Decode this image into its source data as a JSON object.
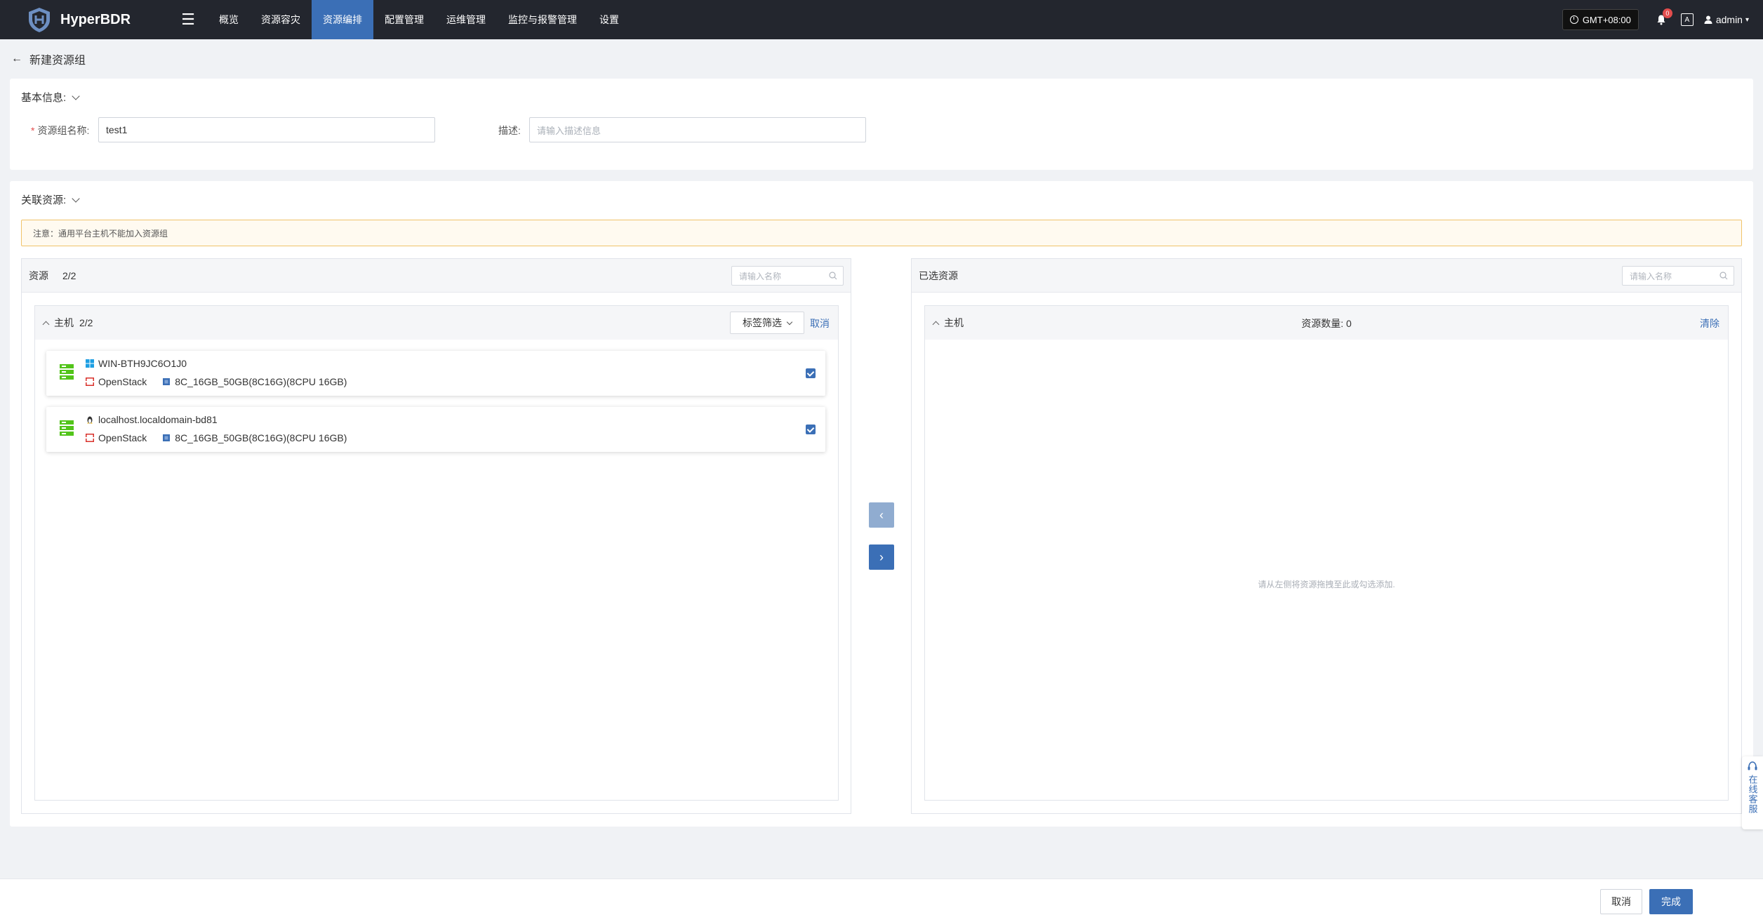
{
  "app": {
    "name": "HyperBDR"
  },
  "nav": {
    "items": [
      {
        "label": "概览",
        "active": false
      },
      {
        "label": "资源容灾",
        "active": false
      },
      {
        "label": "资源编排",
        "active": true
      },
      {
        "label": "配置管理",
        "active": false
      },
      {
        "label": "运维管理",
        "active": false
      },
      {
        "label": "监控与报警管理",
        "active": false
      },
      {
        "label": "设置",
        "active": false
      }
    ]
  },
  "topbar": {
    "timezone": "GMT+08:00",
    "notification_count": "0",
    "user": "admin"
  },
  "page": {
    "title": "新建资源组"
  },
  "basic_info": {
    "title": "基本信息:",
    "name_label": "资源组名称:",
    "name_value": "test1",
    "desc_label": "描述:",
    "desc_placeholder": "请输入描述信息"
  },
  "associated": {
    "title": "关联资源:",
    "notice": "注意：通用平台主机不能加入资源组",
    "left": {
      "title": "资源",
      "count": "2/2",
      "search_placeholder": "请输入名称",
      "group_title": "主机",
      "group_count": "2/2",
      "tag_filter": "标签筛选",
      "cancel": "取消",
      "hosts": [
        {
          "name": "WIN-BTH9JC6O1J0",
          "os": "windows",
          "platform": "OpenStack",
          "flavor": "8C_16GB_50GB(8C16G)(8CPU 16GB)",
          "checked": true
        },
        {
          "name": "localhost.localdomain-bd81",
          "os": "linux",
          "platform": "OpenStack",
          "flavor": "8C_16GB_50GB(8C16G)(8CPU 16GB)",
          "checked": true
        }
      ]
    },
    "right": {
      "title": "已选资源",
      "search_placeholder": "请输入名称",
      "group_title": "主机",
      "count_label": "资源数量: 0",
      "clear": "清除",
      "empty": "请从左侧将资源拖拽至此或勾选添加."
    }
  },
  "service": {
    "label": "在线客服"
  },
  "footer": {
    "cancel": "取消",
    "done": "完成"
  },
  "colors": {
    "accent": "#3b6fb6",
    "topbar": "#23262e",
    "warning_border": "#f0c36a"
  }
}
